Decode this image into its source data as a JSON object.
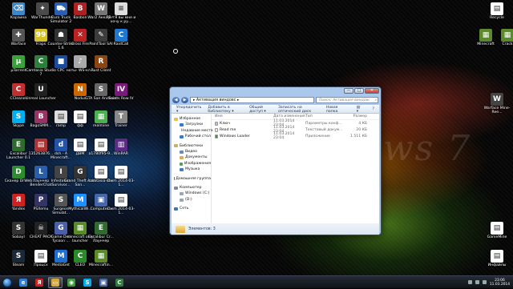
{
  "desktop_icons": [
    {
      "label": "Корзина",
      "color": "#3a88c8",
      "glyph": "⌫"
    },
    {
      "label": "WarThunder",
      "color": "#4a4a4a",
      "glyph": "✦"
    },
    {
      "label": "Euro Truck Simulator 2",
      "color": "#2a5fb4",
      "glyph": "⛟"
    },
    {
      "label": "Basbon",
      "color": "#b02020",
      "glyph": "B"
    },
    {
      "label": "War2 Аккаунт",
      "color": "#777777",
      "glyph": "W"
    },
    {
      "label": "PB - Я вы мне и хочу к ру...",
      "color": "#dddddd",
      "glyph": "≡"
    },
    {
      "label": "Warface",
      "color": "#555555",
      "glyph": "✚"
    },
    {
      "label": "Fraps",
      "color": "#d4c12a",
      "glyph": "99"
    },
    {
      "label": "Counter-Strike 1.6",
      "color": "#333333",
      "glyph": "☗"
    },
    {
      "label": "Cross Fire",
      "color": "#bb2222",
      "glyph": "✕"
    },
    {
      "label": "PaintTool SAI",
      "color": "#3c3c3c",
      "glyph": "✎"
    },
    {
      "label": "RaidCall",
      "color": "#1e78d0",
      "glyph": "C"
    },
    {
      "label": "µTorrent",
      "color": "#3aa23a",
      "glyph": "µ"
    },
    {
      "label": "Camtasia Studio 7",
      "color": "#2e7f3e",
      "glyph": "C"
    },
    {
      "label": "CPC",
      "color": "#1c4c9c",
      "glyph": "■"
    },
    {
      "label": "ноты- WS-кл...",
      "color": "#aaaaaa",
      "glyph": "♪"
    },
    {
      "label": "Rust Client",
      "color": "#8b4513",
      "glyph": "R"
    },
    {
      "label": "CCleaner",
      "color": "#c03030",
      "glyph": "C"
    },
    {
      "label": "Unreal Launcher",
      "color": "#222222",
      "glyph": "U"
    },
    {
      "label": "Nodus",
      "color": "#cc6600",
      "glyph": "N"
    },
    {
      "label": "GTA San Andreas",
      "color": "#666666",
      "glyph": "S"
    },
    {
      "label": "Saints Row IV",
      "color": "#7a1a7a",
      "glyph": "IV"
    },
    {
      "label": "Skype",
      "color": "#00aff0",
      "glyph": "S"
    },
    {
      "label": "BagoSMM...",
      "color": "#993366",
      "glyph": "B"
    },
    {
      "label": "ramp",
      "color": "#dddddd",
      "glyph": "▤"
    },
    {
      "label": "фф",
      "color": "#ffffff",
      "glyph": "▤"
    },
    {
      "label": "realmine",
      "color": "#4caf50",
      "glyph": "▦"
    },
    {
      "label": "Trainer",
      "color": "#888888",
      "glyph": "T"
    },
    {
      "label": "Excalibur Launcher 0.1",
      "color": "#2f6a2f",
      "glyph": "E"
    },
    {
      "label": "135263876...",
      "color": "#aa3333",
      "glyph": "▤"
    },
    {
      "label": "dsh - A Minecraft...",
      "color": "#2255aa",
      "glyph": "d"
    },
    {
      "label": "ДВМ",
      "color": "#ffffff",
      "glyph": "▤"
    },
    {
      "label": "a1780f95-9...",
      "color": "#ffffff",
      "glyph": "▤"
    },
    {
      "label": "WinRAR",
      "color": "#5a2d82",
      "glyph": "▥"
    },
    {
      "label": "Сканер DrWeb",
      "color": "#2d8c2d",
      "glyph": "D"
    },
    {
      "label": "Лаунчер BenderChat",
      "color": "#2a5ea8",
      "glyph": "L"
    },
    {
      "label": "Infestation Survivor...",
      "color": "#444444",
      "glyph": "I"
    },
    {
      "label": "Grand Theft Auto San...",
      "color": "#333333",
      "glyph": "G"
    },
    {
      "label": "camtasia-st...",
      "color": "#ffffff",
      "glyph": "▤"
    },
    {
      "label": "Dwm 2014-03-1...",
      "color": "#ffffff",
      "glyph": "▤"
    },
    {
      "label": "Yandex",
      "color": "#cc2222",
      "glyph": "Я"
    },
    {
      "label": "PSXemu",
      "color": "#333366",
      "glyph": "P"
    },
    {
      "label": "Surgeon Simulat...",
      "color": "#555555",
      "glyph": "S"
    },
    {
      "label": "MythicalWi...",
      "color": "#1e90ff",
      "glyph": "M"
    },
    {
      "label": "Computer...",
      "color": "#4466aa",
      "glyph": "▣"
    },
    {
      "label": "Dwm 2014-03-1...",
      "color": "#ffffff",
      "glyph": "▤"
    },
    {
      "label": "Sobayl",
      "color": "#333333",
      "glyph": "S"
    },
    {
      "label": "CHEAT PACK",
      "color": "#222222",
      "glyph": "☠"
    },
    {
      "label": "Game Dev Tycoon ...",
      "color": "#4b5fa8",
      "glyph": "G"
    },
    {
      "label": "minecraft only launcher",
      "color": "#5a8a2a",
      "glyph": "▦"
    },
    {
      "label": "Excalibur Cr... Лаунчер",
      "color": "#2f6a2f",
      "glyph": "E"
    },
    {
      "label": "Steam",
      "color": "#1b2838",
      "glyph": "S"
    },
    {
      "label": "Процсх",
      "color": "#ffffff",
      "glyph": "▤"
    },
    {
      "label": "MediaGet",
      "color": "#1f6fd0",
      "glyph": "M"
    },
    {
      "label": "CLEO",
      "color": "#2a8a2a",
      "glyph": "C"
    },
    {
      "label": "Minecraftin...",
      "color": "#5a8a2a",
      "glyph": "▦"
    },
    {
      "label": "Recycle",
      "color": "#ffffff",
      "glyph": "▤"
    },
    {
      "label": "Minecraft",
      "color": "#5a8a2a",
      "glyph": "▦"
    },
    {
      "label": "Crack",
      "color": "#5a8a2a",
      "glyph": "▦"
    },
    {
      "label": "Warface Mine-Ree...",
      "color": "#444444",
      "glyph": "W"
    },
    {
      "label": "GameMine",
      "color": "#ffffff",
      "glyph": "▤"
    },
    {
      "label": "Инфайлы",
      "color": "#ffffff",
      "glyph": "▤"
    }
  ],
  "wallpaper_text": "ws 7",
  "explorer": {
    "buttons": {
      "min": "—",
      "max": "□",
      "close": "✕"
    },
    "path": "▸ Активация виндовс ▸",
    "search_placeholder": "Поиск: Активация виндовс",
    "toolbar": [
      "Упорядочить ▾",
      "Добавить в библиотеку ▾",
      "Общий доступ ▾",
      "Записать на оптический диск",
      "Новая папка"
    ],
    "nav": [
      {
        "label": "Избранное",
        "sub": false,
        "color": "#f0c040"
      },
      {
        "label": "Загрузки",
        "sub": true,
        "color": "#3a78c8"
      },
      {
        "label": "Недавние места",
        "sub": true,
        "color": "#b07a3a"
      },
      {
        "label": "Рабочий стол",
        "sub": true,
        "color": "#3a78c8"
      },
      {
        "label": "Библиотеки",
        "sub": false,
        "color": "#d2b05a",
        "gap": true
      },
      {
        "label": "Видео",
        "sub": true,
        "color": "#6a88b0"
      },
      {
        "label": "Документы",
        "sub": true,
        "color": "#d2b05a"
      },
      {
        "label": "Изображения",
        "sub": true,
        "color": "#5a9a5a"
      },
      {
        "label": "Музыка",
        "sub": true,
        "color": "#4a7ab8"
      },
      {
        "label": "Домашняя группа",
        "sub": false,
        "color": "#3a7ab0",
        "gap": true
      },
      {
        "label": "Компьютер",
        "sub": false,
        "color": "#7a8a9a",
        "gap": true
      },
      {
        "label": "Windows (C:)",
        "sub": true,
        "color": "#9aa6b2"
      },
      {
        "label": "(D:)",
        "sub": true,
        "color": "#9aa6b2"
      },
      {
        "label": "Сеть",
        "sub": false,
        "color": "#3a7ab0",
        "gap": true
      }
    ],
    "columns": [
      "Имя",
      "Дата изменения",
      "Тип",
      "Размер"
    ],
    "files": [
      {
        "name": "Ключ",
        "date": "11.03.2014 23:04",
        "type": "Параметры конф...",
        "size": "4 КБ",
        "color": "#b8c4d4"
      },
      {
        "name": "Read me",
        "date": "11.03.2014 23:04",
        "type": "Текстовый докум...",
        "size": "20 КБ",
        "color": "#e8e8e8"
      },
      {
        "name": "Windows Loader",
        "date": "11.03.2014 23:04",
        "type": "Приложение",
        "size": "1 511 КБ",
        "color": "#3a9a3a"
      }
    ],
    "status": "Элементов: 3"
  },
  "taskbar": {
    "buttons": [
      {
        "name": "taskbar-ie",
        "glyph": "e",
        "color": "#2f7fd8"
      },
      {
        "name": "taskbar-yandex",
        "glyph": "Я",
        "color": "#cc2222"
      },
      {
        "name": "taskbar-explorer",
        "glyph": "▭",
        "color": "#d9a83a"
      },
      {
        "name": "taskbar-chrome",
        "glyph": "◉",
        "color": "#3c9a3c"
      },
      {
        "name": "taskbar-skype",
        "glyph": "S",
        "color": "#00aff0"
      },
      {
        "name": "taskbar-app",
        "glyph": "▣",
        "color": "#4a6aa8"
      },
      {
        "name": "taskbar-camtasia",
        "glyph": "C",
        "color": "#2e7f3e"
      }
    ],
    "clock_time": "23:06",
    "clock_date": "11.03.2014"
  }
}
